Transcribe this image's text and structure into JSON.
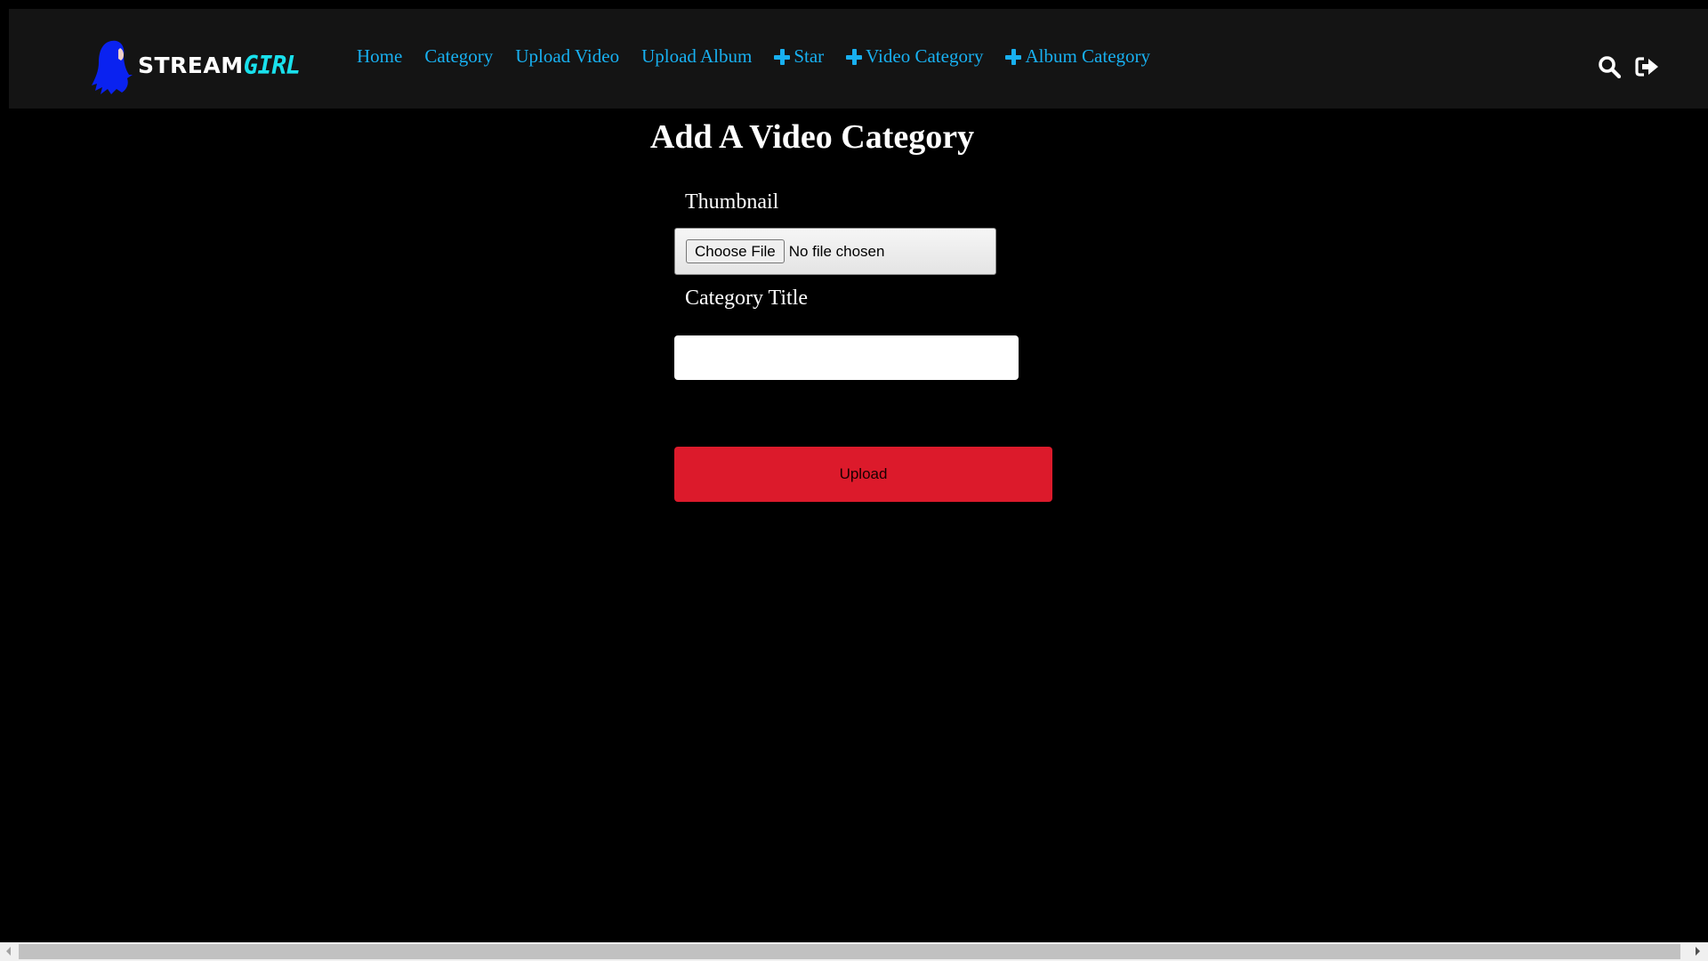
{
  "header": {
    "logo": {
      "text_main": "STREAM",
      "text_accent": "GIRL",
      "icon": "girl-silhouette-icon"
    },
    "nav": [
      {
        "label": "Home",
        "icon": null
      },
      {
        "label": "Category",
        "icon": null
      },
      {
        "label": "Upload Video",
        "icon": null
      },
      {
        "label": "Upload Album",
        "icon": null
      },
      {
        "label": "Star",
        "icon": "plus-icon"
      },
      {
        "label": "Video Category",
        "icon": "plus-icon"
      },
      {
        "label": "Album Category",
        "icon": "plus-icon"
      }
    ],
    "actions": [
      {
        "icon": "search-icon"
      },
      {
        "icon": "sign-out-icon"
      }
    ]
  },
  "page": {
    "title": "Add A Video Category"
  },
  "form": {
    "thumbnail_label": "Thumbnail",
    "file_button_label": "Choose File",
    "file_status": "No file chosen",
    "category_title_label": "Category Title",
    "category_title_value": "",
    "submit_label": "Upload"
  },
  "colors": {
    "header_bg": "#141414",
    "nav_link": "#18b0f0",
    "logo_accent": "#19e0ec",
    "logo_figure": "#0a22f0",
    "upload_button": "#dc1a2b",
    "page_bg": "#000000"
  }
}
